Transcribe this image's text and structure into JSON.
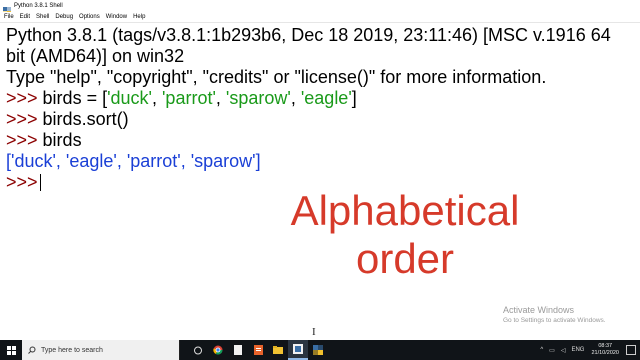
{
  "window": {
    "title": "Python 3.8.1 Shell"
  },
  "menu": [
    "File",
    "Edit",
    "Shell",
    "Debug",
    "Options",
    "Window",
    "Help"
  ],
  "shell": {
    "banner_line1": "Python 3.8.1 (tags/v3.8.1:1b293b6, Dec 18 2019, 23:11:46) [MSC v.1916 64",
    "banner_line2": "bit (AMD64)] on win32",
    "banner_line3": "Type \"help\", \"copyright\", \"credits\" or \"license()\" for more information.",
    "prompt": ">>>",
    "cmd1_prefix": " birds = [",
    "cmd1_items": [
      "'duck'",
      "'parrot'",
      "'sparow'",
      "'eagle'"
    ],
    "sep": ", ",
    "close_bracket": "]",
    "cmd2": " birds.sort()",
    "cmd3": " birds",
    "output": "['duck', 'eagle', 'parrot', 'sparow']"
  },
  "overlay": {
    "line1": "Alphabetical",
    "line2": "order"
  },
  "watermark": {
    "title": "Activate Windows",
    "subtitle": "Go to Settings to activate Windows."
  },
  "taskbar": {
    "search_placeholder": "Type here to search",
    "tray_lang": "ENG",
    "time": "08:37",
    "date": "21/10/2020"
  },
  "colors": {
    "prompt": "#8b0000",
    "string": "#1a9a1a",
    "output": "#1a3fd6",
    "overlay": "#d63a2a"
  }
}
